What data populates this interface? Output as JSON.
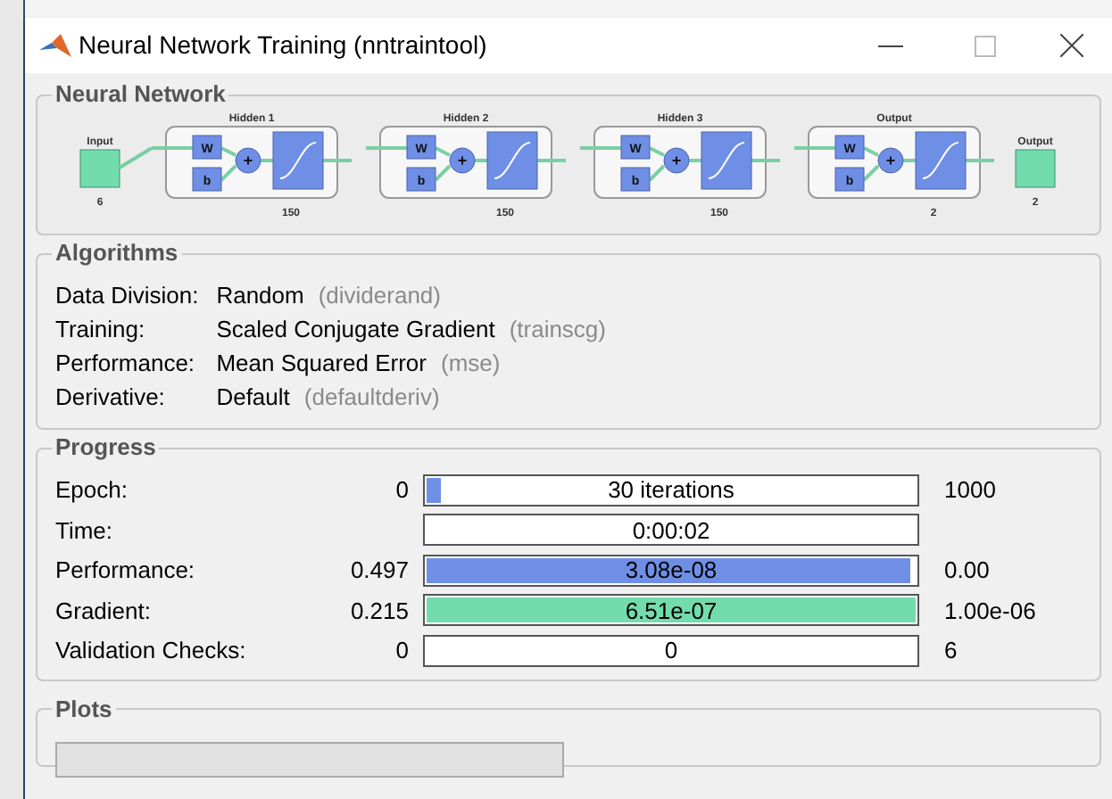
{
  "window": {
    "title": "Neural Network Training (nntraintool)"
  },
  "network": {
    "title": "Neural Network",
    "input": {
      "label": "Input",
      "size": "6"
    },
    "output": {
      "label": "Output",
      "size": "2"
    },
    "layers": [
      {
        "title": "Hidden 1",
        "size": "150",
        "weight": "W",
        "bias": "b",
        "sum": "+"
      },
      {
        "title": "Hidden 2",
        "size": "150",
        "weight": "W",
        "bias": "b",
        "sum": "+"
      },
      {
        "title": "Hidden 3",
        "size": "150",
        "weight": "W",
        "bias": "b",
        "sum": "+"
      },
      {
        "title": "Output",
        "size": "2",
        "weight": "W",
        "bias": "b",
        "sum": "+"
      }
    ]
  },
  "algorithms": {
    "title": "Algorithms",
    "rows": [
      {
        "label": "Data Division:",
        "value": "Random",
        "function": "(dividerand)"
      },
      {
        "label": "Training:",
        "value": "Scaled Conjugate Gradient",
        "function": "(trainscg)"
      },
      {
        "label": "Performance:",
        "value": "Mean Squared Error",
        "function": "(mse)"
      },
      {
        "label": "Derivative:",
        "value": "Default",
        "function": "(defaultderiv)"
      }
    ]
  },
  "progress": {
    "title": "Progress",
    "rows": [
      {
        "label": "Epoch:",
        "start": "0",
        "bar": "30 iterations",
        "level": 0.03,
        "color": "#6f8fe6",
        "end": "1000"
      },
      {
        "label": "Time:",
        "bar": "0:00:02"
      },
      {
        "label": "Performance:",
        "start": "0.497",
        "bar": "3.08e-08",
        "level": 0.99,
        "color": "#6f8fe6",
        "end": "0.00"
      },
      {
        "label": "Gradient:",
        "start": "0.215",
        "bar": "6.51e-07",
        "level": 1,
        "color": "#73dcac",
        "end": "1.00e-06"
      },
      {
        "label": "Validation Checks:",
        "start": "0",
        "bar": "0",
        "end": "6"
      }
    ]
  },
  "plots": {
    "title": "Plots"
  }
}
